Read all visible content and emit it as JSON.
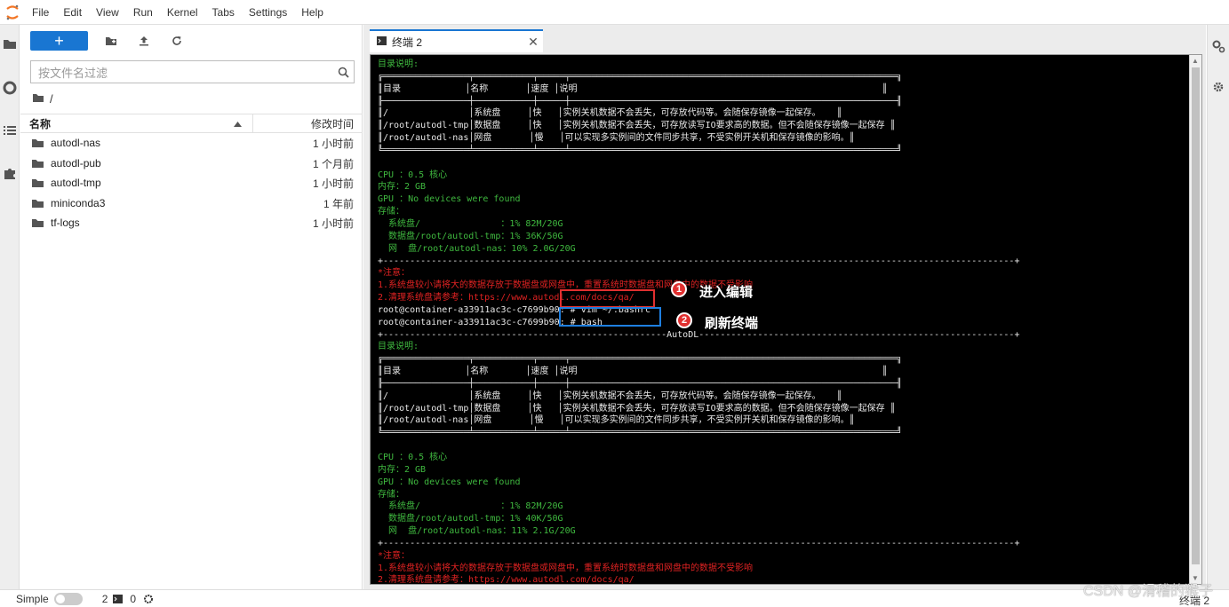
{
  "menubar": {
    "items": [
      "File",
      "Edit",
      "View",
      "Run",
      "Kernel",
      "Tabs",
      "Settings",
      "Help"
    ]
  },
  "toolbar": {
    "new_label": "+"
  },
  "filter": {
    "placeholder": "按文件名过滤"
  },
  "breadcrumb": {
    "path": "/"
  },
  "filelist": {
    "col_name": "名称",
    "col_modified": "修改时间",
    "rows": [
      {
        "name": "autodl-nas",
        "modified": "1 小时前"
      },
      {
        "name": "autodl-pub",
        "modified": "1 个月前"
      },
      {
        "name": "autodl-tmp",
        "modified": "1 小时前"
      },
      {
        "name": "miniconda3",
        "modified": "1 年前"
      },
      {
        "name": "tf-logs",
        "modified": "1 小时前"
      }
    ]
  },
  "tab": {
    "label": "终端 2",
    "close": "✕"
  },
  "terminal": {
    "lines": [
      {
        "c": "g",
        "t": "目录说明:"
      },
      {
        "c": "w",
        "t": "╔════════════════╤═══════════╤═════╤═════════════════════════════════════════════════════════════╗"
      },
      {
        "c": "w",
        "t": "║目录            │名称       │速度 │说明                                                         ║"
      },
      {
        "c": "w",
        "t": "╟────────────────┼───────────┼─────┼─────────────────────────────────────────────────────────────╢"
      },
      {
        "c": "w",
        "t": "║/               │系统盘     │快   │实例关机数据不会丢失，可存放代码等。会随保存镜像一起保存。   ║"
      },
      {
        "c": "w",
        "t": "║/root/autodl-tmp│数据盘     │快   │实例关机数据不会丢失，可存放读写IO要求高的数据。但不会随保存镜像一起保存 ║"
      },
      {
        "c": "w",
        "t": "║/root/autodl-nas│网盘       │慢   │可以实现多实例间的文件同步共享，不受实例开关机和保存镜像的影响。║"
      },
      {
        "c": "w",
        "t": "╚════════════════╧═══════════╧═════╧═════════════════════════════════════════════════════════════╝"
      },
      {
        "c": "w",
        "t": ""
      },
      {
        "c": "g",
        "t": "CPU ：0.5 核心"
      },
      {
        "c": "g",
        "t": "内存：2 GB"
      },
      {
        "c": "g",
        "t": "GPU ：No devices were found"
      },
      {
        "c": "g",
        "t": "存储："
      },
      {
        "c": "g",
        "t": "  系统盘/               ：1% 82M/20G"
      },
      {
        "c": "g",
        "t": "  数据盘/root/autodl-tmp：1% 36K/50G"
      },
      {
        "c": "g",
        "t": "  网  盘/root/autodl-nas：10% 2.0G/20G"
      },
      {
        "c": "w",
        "t": "+----------------------------------------------------------------------------------------------------------------------+"
      },
      {
        "c": "r",
        "t": "*注意："
      },
      {
        "c": "r",
        "t": "1.系统盘较小请将大的数据存放于数据盘或网盘中，重置系统时数据盘和网盘中的数据不受影响"
      },
      {
        "c": "r",
        "t": "2.清理系统盘请参考：https://www.autodl.com/docs/qa/"
      },
      {
        "c": "w",
        "t": "root@container-a33911ac3c-c7699b90: # vim ~/.bashrc"
      },
      {
        "c": "w",
        "t": "root@container-a33911ac3c-c7699b90: # bash"
      },
      {
        "c": "w",
        "t": "+-----------------------------------------------------AutoDL-----------------------------------------------------------+"
      },
      {
        "c": "g",
        "t": "目录说明:"
      },
      {
        "c": "w",
        "t": "╔════════════════╤═══════════╤═════╤═════════════════════════════════════════════════════════════╗"
      },
      {
        "c": "w",
        "t": "║目录            │名称       │速度 │说明                                                         ║"
      },
      {
        "c": "w",
        "t": "╟────────────────┼───────────┼─────┼─────────────────────────────────────────────────────────────╢"
      },
      {
        "c": "w",
        "t": "║/               │系统盘     │快   │实例关机数据不会丢失，可存放代码等。会随保存镜像一起保存。   ║"
      },
      {
        "c": "w",
        "t": "║/root/autodl-tmp│数据盘     │快   │实例关机数据不会丢失，可存放读写IO要求高的数据。但不会随保存镜像一起保存 ║"
      },
      {
        "c": "w",
        "t": "║/root/autodl-nas│网盘       │慢   │可以实现多实例间的文件同步共享，不受实例开关机和保存镜像的影响。║"
      },
      {
        "c": "w",
        "t": "╚════════════════╧═══════════╧═════╧═════════════════════════════════════════════════════════════╝"
      },
      {
        "c": "w",
        "t": ""
      },
      {
        "c": "g",
        "t": "CPU ：0.5 核心"
      },
      {
        "c": "g",
        "t": "内存：2 GB"
      },
      {
        "c": "g",
        "t": "GPU ：No devices were found"
      },
      {
        "c": "g",
        "t": "存储："
      },
      {
        "c": "g",
        "t": "  系统盘/               ：1% 82M/20G"
      },
      {
        "c": "g",
        "t": "  数据盘/root/autodl-tmp：1% 40K/50G"
      },
      {
        "c": "g",
        "t": "  网  盘/root/autodl-nas：11% 2.1G/20G"
      },
      {
        "c": "w",
        "t": "+----------------------------------------------------------------------------------------------------------------------+"
      },
      {
        "c": "r",
        "t": "*注意："
      },
      {
        "c": "r",
        "t": "1.系统盘较小请将大的数据存放于数据盘或网盘中，重置系统时数据盘和网盘中的数据不受影响"
      },
      {
        "c": "r",
        "t": "2.清理系统盘请参考：https://www.autodl.com/docs/qa/"
      }
    ],
    "prompt": "root@container-a33911ac3c-c7699b90: # "
  },
  "annotations": {
    "step1_num": "1",
    "step1_label": "进入编辑",
    "step2_num": "2",
    "step2_label": "刷新终端",
    "colors": {
      "step1": "#e03030",
      "step2": "#1e7fe0"
    }
  },
  "statusbar": {
    "mode": "Simple",
    "terminals": "2",
    "kernels": "0",
    "active": "终端 2"
  },
  "watermark": "CSDN @滑稽的猴子"
}
